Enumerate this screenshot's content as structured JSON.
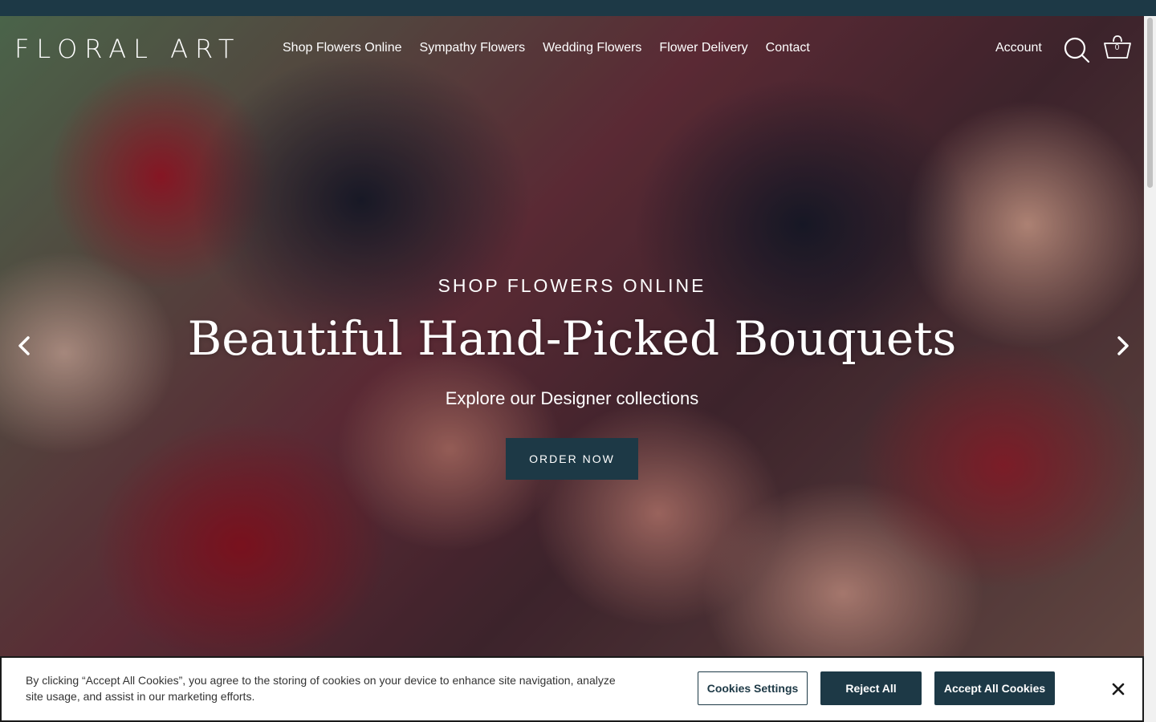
{
  "header": {
    "logo": "FLORAL ART",
    "nav": [
      {
        "label": "Shop Flowers Online"
      },
      {
        "label": "Sympathy Flowers"
      },
      {
        "label": "Wedding Flowers"
      },
      {
        "label": "Flower Delivery"
      },
      {
        "label": "Contact"
      }
    ],
    "account_label": "Account",
    "search_icon": "search-icon",
    "cart_icon": "cart-icon",
    "cart_count": "0"
  },
  "hero": {
    "kicker": "SHOP FLOWERS ONLINE",
    "title": "Beautiful Hand-Picked Bouquets",
    "subtitle": "Explore our Designer collections",
    "cta_label": "ORDER NOW",
    "prev_icon": "chevron-left-icon",
    "next_icon": "chevron-right-icon"
  },
  "cookie_banner": {
    "text": "By clicking “Accept All Cookies”, you agree to the storing of cookies on your device to enhance site navigation, analyze site usage, and assist in our marketing efforts.",
    "settings_label": "Cookies Settings",
    "reject_label": "Reject All",
    "accept_label": "Accept All Cookies",
    "close_icon": "close-icon"
  },
  "colors": {
    "brand_dark": "#1d3946",
    "white": "#ffffff"
  }
}
